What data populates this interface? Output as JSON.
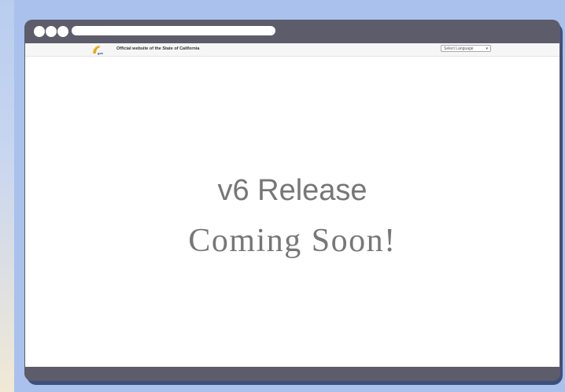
{
  "site_header": {
    "official_text": "Official website of the State of California",
    "logo_icon": "ca-gov-logo-icon"
  },
  "language_select": {
    "selected": "Select Language",
    "chevron_icon": "chevron-down-icon"
  },
  "main": {
    "headline": "v6 Release",
    "subline": "Coming Soon!"
  },
  "colors": {
    "page_background": "#a9c1ec",
    "browser_frame": "#5d5c6b",
    "frame_shadow": "#3c4f7c",
    "text_gray": "#777777",
    "logo_gold": "#f3b92a"
  }
}
